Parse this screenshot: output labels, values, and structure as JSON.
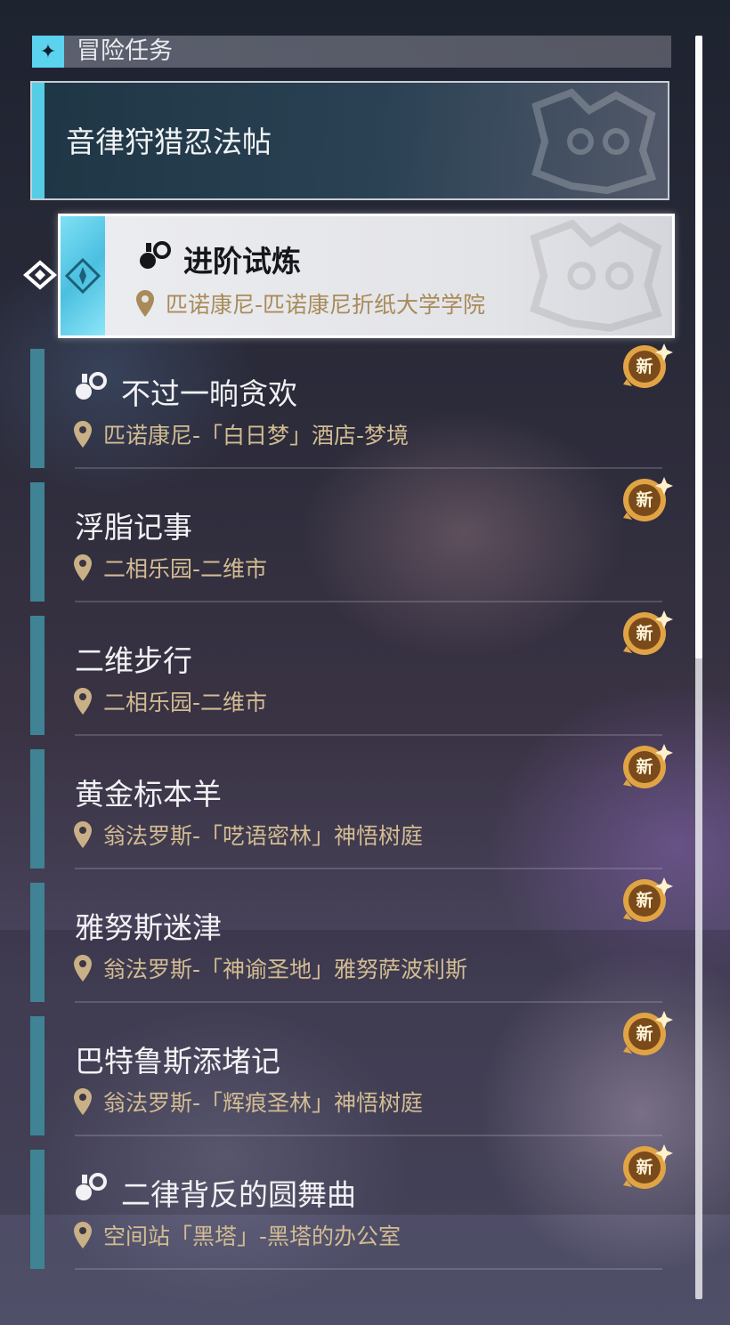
{
  "section": {
    "title": "冒险任务",
    "icon": "sparkle-star-icon"
  },
  "category": {
    "title": "音律狩猎忍法帖"
  },
  "selected_quest": {
    "title": "进阶试炼",
    "location": "匹诺康尼-匹诺康尼折纸大学学院",
    "icon": "quest-chain-icon"
  },
  "quests": [
    {
      "title": "不过一晌贪欢",
      "location": "匹诺康尼-「白日梦」酒店-梦境",
      "badge": "新",
      "has_icon": true
    },
    {
      "title": "浮脂记事",
      "location": "二相乐园-二维市",
      "badge": "新",
      "has_icon": false
    },
    {
      "title": "二维步行",
      "location": "二相乐园-二维市",
      "badge": "新",
      "has_icon": false
    },
    {
      "title": "黄金标本羊",
      "location": "翁法罗斯-「呓语密林」神悟树庭",
      "badge": "新",
      "has_icon": false
    },
    {
      "title": "雅努斯迷津",
      "location": "翁法罗斯-「神谕圣地」雅努萨波利斯",
      "badge": "新",
      "has_icon": false
    },
    {
      "title": "巴特鲁斯添堵记",
      "location": "翁法罗斯-「辉痕圣林」神悟树庭",
      "badge": "新",
      "has_icon": false
    },
    {
      "title": "二律背反的圆舞曲",
      "location": "空间站「黑塔」-黑塔的办公室",
      "badge": "新",
      "has_icon": true
    }
  ],
  "colors": {
    "accent": "#56cde6",
    "location_text": "#d2bc92",
    "badge": "#e0a445",
    "quest_bar": "#3f8394"
  }
}
